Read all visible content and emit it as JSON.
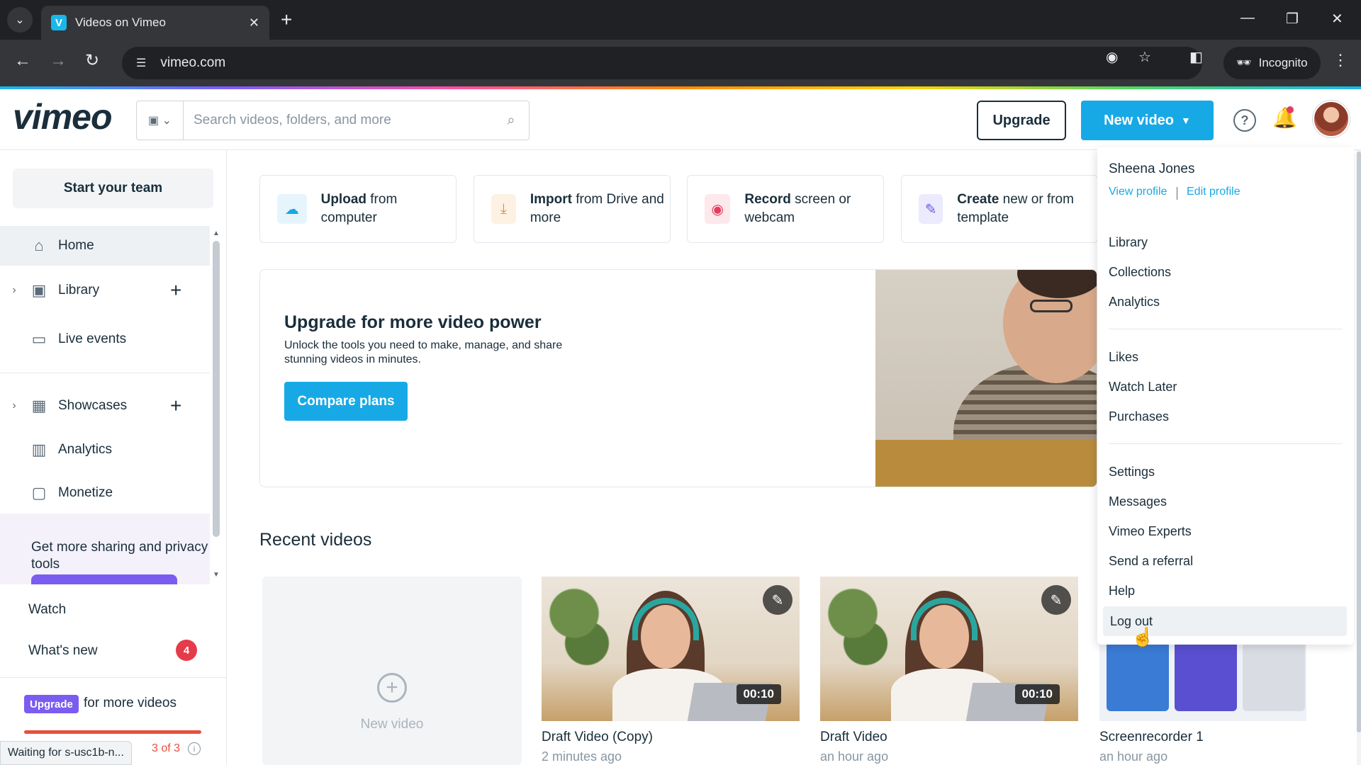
{
  "browser": {
    "tab_title": "Videos on Vimeo",
    "url": "vimeo.com",
    "incognito_label": "Incognito"
  },
  "header": {
    "logo": "vimeo",
    "search_placeholder": "Search videos, folders, and more",
    "upgrade_label": "Upgrade",
    "new_video_label": "New video"
  },
  "sidebar": {
    "start_team": "Start your team",
    "items": [
      {
        "label": "Home"
      },
      {
        "label": "Library"
      },
      {
        "label": "Live events"
      },
      {
        "label": "Showcases"
      },
      {
        "label": "Analytics"
      },
      {
        "label": "Monetize"
      }
    ],
    "promo_text": "Get more sharing and privacy tools",
    "watch": "Watch",
    "whats_new": "What's new",
    "whats_new_count": "4",
    "upgrade_pill": "Upgrade",
    "upgrade_text": "for more videos",
    "quota": "3 of 3",
    "quota_fraction": 1.0
  },
  "status_bar": "Waiting for s-usc1b-n...",
  "quick_actions": [
    {
      "bold": "Upload",
      "rest": " from computer"
    },
    {
      "bold": "Import",
      "rest": " from Drive and more"
    },
    {
      "bold": "Record",
      "rest": " screen or webcam"
    },
    {
      "bold": "Create",
      "rest": " new or from template"
    }
  ],
  "upgrade_card": {
    "title": "Upgrade for more video power",
    "body": "Unlock the tools you need to make, manage, and share stunning videos in minutes.",
    "button": "Compare plans"
  },
  "recent": {
    "title": "Recent videos",
    "new_video_label": "New video",
    "videos": [
      {
        "title": "Draft Video (Copy)",
        "time": "2 minutes ago",
        "duration": "00:10"
      },
      {
        "title": "Draft Video",
        "time": "an hour ago",
        "duration": "00:10"
      },
      {
        "title": "Screenrecorder 1",
        "time": "an hour ago"
      }
    ]
  },
  "user_menu": {
    "name": "Sheena Jones",
    "view_profile": "View profile",
    "edit_profile": "Edit profile",
    "group1": [
      "Library",
      "Collections",
      "Analytics"
    ],
    "group2": [
      "Likes",
      "Watch Later",
      "Purchases"
    ],
    "group3": [
      "Settings",
      "Messages",
      "Vimeo Experts",
      "Send a referral",
      "Help",
      "Log out"
    ]
  },
  "colors": {
    "brand_blue": "#17a9e6",
    "upgrade_purple": "#7b5cf0",
    "badge_red": "#e63b4a"
  }
}
